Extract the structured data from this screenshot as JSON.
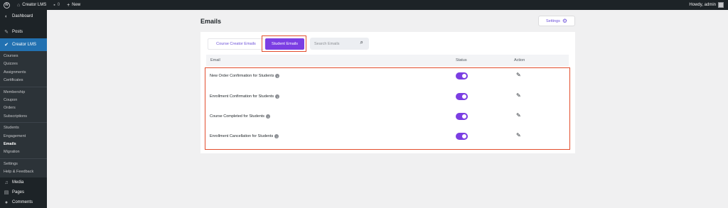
{
  "adminbar": {
    "site_name": "Creator LMS",
    "comments_count": "0",
    "new_label": "New",
    "howdy": "Howdy, admin"
  },
  "sidebar": {
    "top": [
      {
        "label": "Dashboard",
        "icon": "dashboard-icon"
      },
      {
        "label": "Posts",
        "icon": "pin-icon"
      },
      {
        "label": "Creator LMS",
        "icon": "lms-icon"
      }
    ],
    "submenu_groups": [
      [
        "Courses",
        "Quizzes",
        "Assignments",
        "Certificates"
      ],
      [
        "Membership",
        "Coupon",
        "Orders",
        "Subscriptions"
      ],
      [
        "Students",
        "Engagement",
        "Emails",
        "Migration"
      ],
      [
        "Settings",
        "Help & Feedback"
      ]
    ],
    "active_item": "Emails",
    "bottom": [
      {
        "label": "Media",
        "icon": "media-icon"
      },
      {
        "label": "Pages",
        "icon": "pages-icon"
      },
      {
        "label": "Comments",
        "icon": "comments-icon"
      }
    ]
  },
  "main": {
    "title": "Emails",
    "settings_label": "Settings",
    "tabs": [
      {
        "label": "Course Creator Emails",
        "active": false
      },
      {
        "label": "Student Emails",
        "active": true
      }
    ],
    "search_placeholder": "Search Emails",
    "columns": {
      "email": "Email",
      "status": "Status",
      "action": "Action"
    },
    "rows": [
      {
        "name": "New Order Confirmation for Students",
        "enabled": true
      },
      {
        "name": "Enrollment Confirmation for Students",
        "enabled": true
      },
      {
        "name": "Course Completed for Students",
        "enabled": true
      },
      {
        "name": "Enrollment Cancellation for Students",
        "enabled": true
      }
    ]
  },
  "colors": {
    "accent": "#7b3ee3",
    "highlight_outline": "#e24d2c",
    "sidebar_bg": "#1d2327",
    "sidebar_current": "#2271b1"
  }
}
